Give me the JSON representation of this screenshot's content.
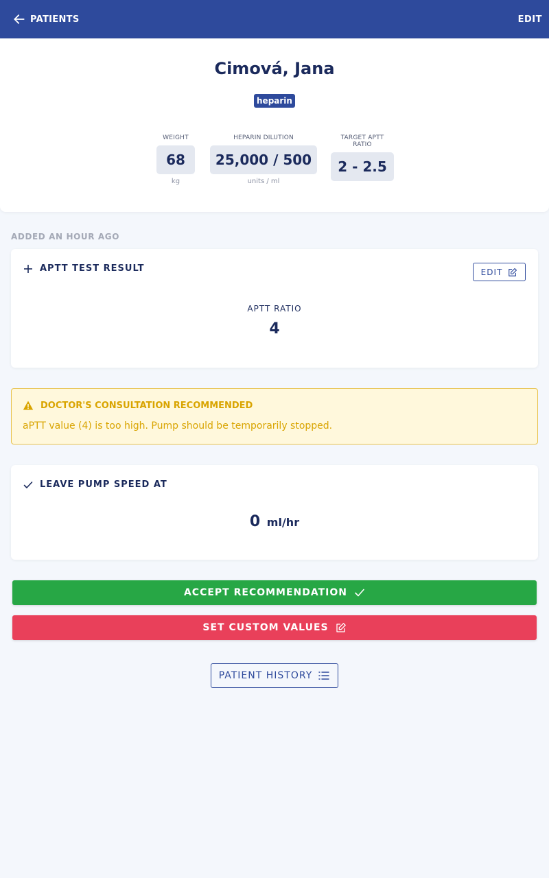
{
  "topbar": {
    "back_label": "PATIENTS",
    "edit_label": "EDIT",
    "background": "#2e4a9c"
  },
  "patient": {
    "name": "Cimová, Jana",
    "drug_badge": "heparin",
    "stats": [
      {
        "label": "WEIGHT",
        "value": "68",
        "unit": "kg"
      },
      {
        "label": "HEPARIN DILUTION",
        "value": "25,000 / 500",
        "unit": "units / ml"
      },
      {
        "label": "TARGET APTT RATIO",
        "value": "2 - 2.5",
        "unit": ""
      }
    ]
  },
  "timeline": {
    "added_label": "ADDED AN HOUR AGO"
  },
  "test_result": {
    "title": "APTT TEST RESULT",
    "edit_label": "EDIT",
    "ratio_label": "APTT RATIO",
    "ratio_value": "4"
  },
  "warning": {
    "title": "DOCTOR'S CONSULTATION RECOMMENDED",
    "message": "aPTT value (4) is too high. Pump should be temporarily stopped.",
    "color": "#d9a400"
  },
  "pump": {
    "title": "LEAVE PUMP SPEED AT",
    "value": "0",
    "unit": "ml/hr"
  },
  "actions": {
    "accept_label": "ACCEPT RECOMMENDATION",
    "accept_color": "#27a745",
    "custom_label": "SET CUSTOM VALUES",
    "custom_color": "#e9405a",
    "history_label": "PATIENT HISTORY"
  },
  "icons": {
    "back": "arrow-left-icon",
    "add": "plus-icon",
    "edit": "edit-square-icon",
    "warning": "warning-triangle-icon",
    "check": "check-icon",
    "list": "list-icon"
  }
}
